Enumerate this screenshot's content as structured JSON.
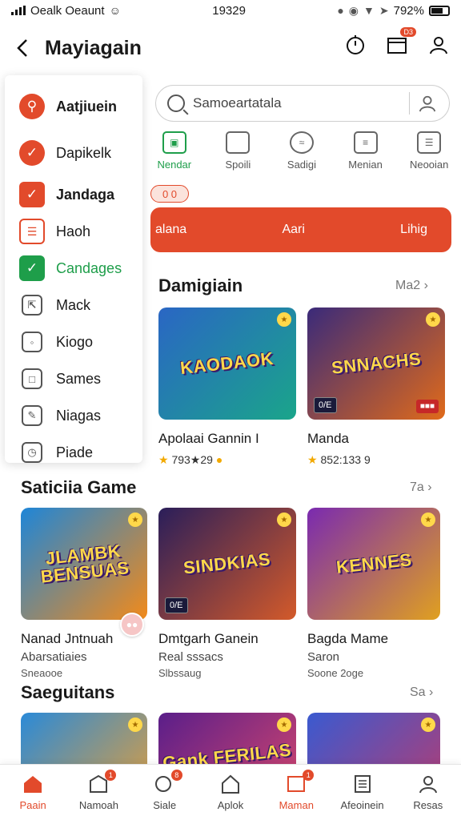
{
  "status_bar": {
    "carrier": "Oealk Oeaunt",
    "time": "19329",
    "battery": "792%"
  },
  "header": {
    "title": "Mayiagain",
    "cart_badge": "D3"
  },
  "drawer": {
    "items": [
      {
        "label": "Aatjiuein",
        "icon": "search-icon"
      },
      {
        "label": "Dapikelk",
        "icon": "pencil-icon"
      },
      {
        "label": "Jandaga",
        "icon": "checkbox-icon"
      },
      {
        "label": "Haoh",
        "icon": "list-icon"
      },
      {
        "label": "Candages",
        "icon": "check-icon"
      },
      {
        "label": "Mack",
        "icon": "flag-icon"
      },
      {
        "label": "Kiogo",
        "icon": "tag-icon"
      },
      {
        "label": "Sames",
        "icon": "book-icon"
      },
      {
        "label": "Niagas",
        "icon": "edit-icon"
      },
      {
        "label": "Piade",
        "icon": "clock-icon"
      }
    ]
  },
  "search": {
    "placeholder": "Samoeartatala"
  },
  "categories": [
    {
      "label": "Nendar",
      "icon": "bag-icon"
    },
    {
      "label": "Spoili",
      "icon": "chat-icon"
    },
    {
      "label": "Sadigi",
      "icon": "wifi-icon"
    },
    {
      "label": "Menian",
      "icon": "grid-icon"
    },
    {
      "label": "Neooian",
      "icon": "doc-icon"
    }
  ],
  "promo": {
    "badge": "0 0",
    "left": "alana",
    "center": "Aari",
    "right": "Lihig"
  },
  "section1": {
    "title": "Damigiain",
    "more": "Ma2",
    "games": [
      {
        "title": "Apolaai Gannin I",
        "rating": "793★29",
        "art_text": "KAODAOK",
        "bg1": "#2a66c4",
        "bg2": "#1aa58a",
        "tag": ""
      },
      {
        "title": "Manda",
        "rating": "852:133 9",
        "art_text": "SNNACHS",
        "bg1": "#3a2a7a",
        "bg2": "#e06a1a",
        "tag": "0/E"
      }
    ]
  },
  "section2": {
    "title": "Saticiia Game",
    "more": "7a",
    "games": [
      {
        "title": "Nanad Jntnuah",
        "sub": "Abarsatiaies",
        "sub2": "Sneaooe",
        "art_text": "JLAMBK BENSUAS",
        "bg1": "#1e86d8",
        "bg2": "#f28a1a",
        "tag": ""
      },
      {
        "title": "Dmtgarh Ganein",
        "sub": "Real sssacs",
        "sub2": "Slbssaug",
        "art_text": "SINDKIAS",
        "bg1": "#2a1e5a",
        "bg2": "#d35a2a",
        "tag": "0/E"
      },
      {
        "title": "Bagda Mame",
        "sub": "Saron",
        "sub2": "Soone 2oge",
        "art_text": "KENNES",
        "bg1": "#7a2ab0",
        "bg2": "#e0a020",
        "tag": ""
      }
    ]
  },
  "section3": {
    "title": "Saeguitans",
    "more": "Sa",
    "games": [
      {
        "art_text": "",
        "bg1": "#2a8ad8",
        "bg2": "#f0a030"
      },
      {
        "art_text": "Gank FERILAS",
        "bg1": "#5a1e8a",
        "bg2": "#e04a6a"
      },
      {
        "art_text": "",
        "bg1": "#3a5ad0",
        "bg2": "#c03a6a"
      }
    ]
  },
  "bottom_nav": [
    {
      "label": "Paain",
      "icon": "home-icon",
      "active": true,
      "badge": ""
    },
    {
      "label": "Namoah",
      "icon": "shop-icon",
      "active": false,
      "badge": "1"
    },
    {
      "label": "Siale",
      "icon": "game-icon",
      "active": false,
      "badge": "8"
    },
    {
      "label": "Aplok",
      "icon": "house-icon",
      "active": false,
      "badge": ""
    },
    {
      "label": "Maman",
      "icon": "message-icon",
      "active": false,
      "badge": "1"
    },
    {
      "label": "Afeoinein",
      "icon": "receipt-icon",
      "active": false,
      "badge": ""
    },
    {
      "label": "Resas",
      "icon": "profile-icon",
      "active": false,
      "badge": ""
    }
  ],
  "colors": {
    "accent": "#e24a2b",
    "green": "#1e9e4a"
  }
}
